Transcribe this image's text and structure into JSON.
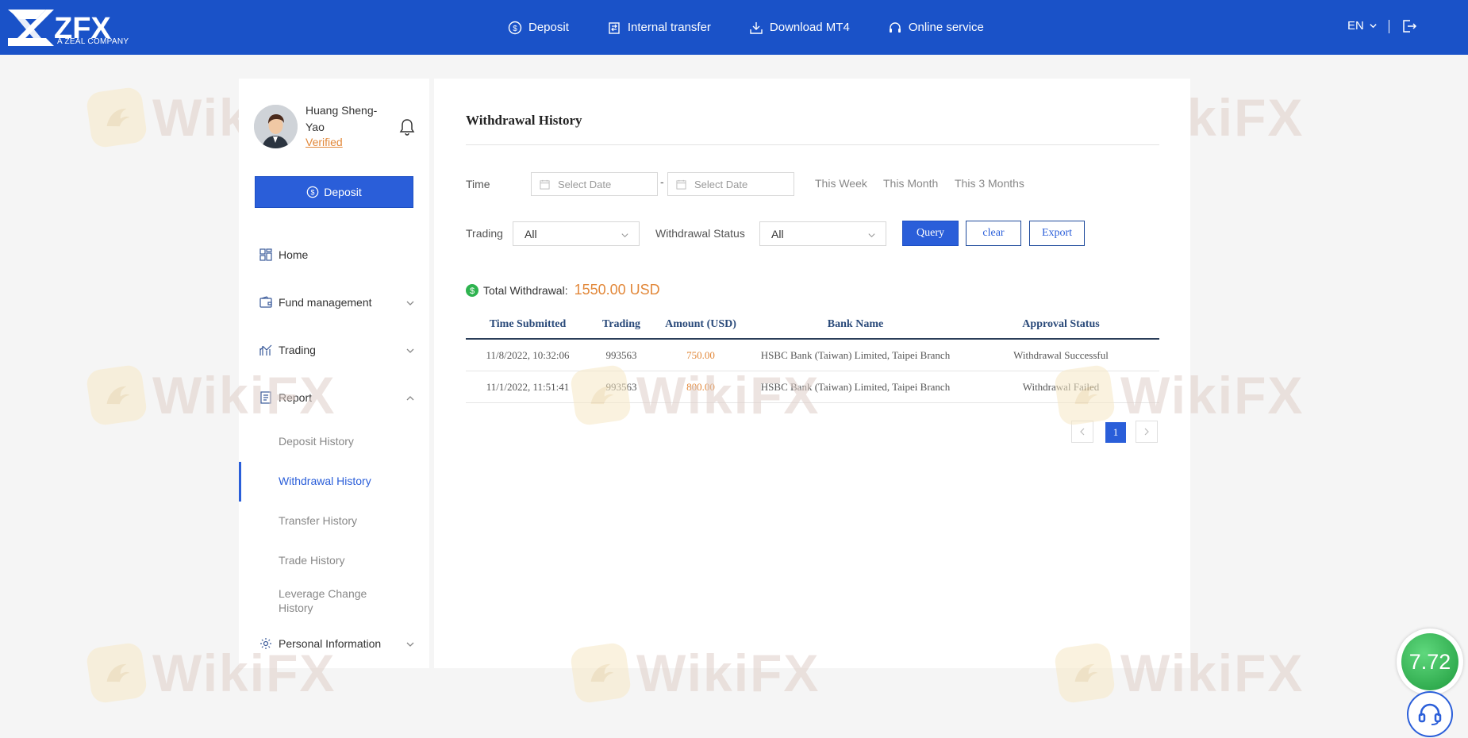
{
  "brand": {
    "name": "ZFX",
    "tagline": "A ZEAL COMPANY"
  },
  "topnav": {
    "items": [
      {
        "label": "Deposit",
        "icon": "dollar-circle-icon"
      },
      {
        "label": "Internal transfer",
        "icon": "transfer-icon"
      },
      {
        "label": "Download MT4",
        "icon": "download-icon"
      },
      {
        "label": "Online service",
        "icon": "headset-icon"
      }
    ],
    "language": "EN"
  },
  "profile": {
    "name": "Huang Sheng-Yao",
    "status": "Verified",
    "deposit_label": "Deposit"
  },
  "sidebar": {
    "items": [
      {
        "label": "Home",
        "icon": "grid-icon"
      },
      {
        "label": "Fund management",
        "icon": "wallet-icon"
      },
      {
        "label": "Trading",
        "icon": "chart-icon"
      },
      {
        "label": "Report",
        "icon": "report-icon"
      },
      {
        "label": "Personal Information",
        "icon": "gear-icon"
      }
    ],
    "report_sub": [
      {
        "label": "Deposit History"
      },
      {
        "label": "Withdrawal History",
        "active": true
      },
      {
        "label": "Transfer History"
      },
      {
        "label": "Trade History"
      },
      {
        "label": "Leverage Change History"
      }
    ]
  },
  "main": {
    "title": "Withdrawal History",
    "filters": {
      "time_label": "Time",
      "start_placeholder": "Select Date",
      "end_placeholder": "Select Date",
      "separator": "-",
      "quick": [
        "This Week",
        "This Month",
        "This 3 Months"
      ],
      "trading_label": "Trading",
      "trading_value": "All",
      "status_label": "Withdrawal Status",
      "status_value": "All",
      "query_label": "Query",
      "clear_label": "clear",
      "export_label": "Export"
    },
    "total": {
      "label": "Total Withdrawal:",
      "value": "1550.00 USD"
    },
    "table": {
      "headers": [
        "Time Submitted",
        "Trading",
        "Amount (USD)",
        "Bank Name",
        "Approval Status"
      ],
      "rows": [
        [
          "11/8/2022, 10:32:06",
          "993563",
          "750.00",
          "HSBC Bank (Taiwan) Limited, Taipei Branch",
          "Withdrawal Successful"
        ],
        [
          "11/1/2022, 11:51:41",
          "993563",
          "800.00",
          "HSBC Bank (Taiwan) Limited, Taipei Branch",
          "Withdrawal Failed"
        ]
      ]
    },
    "pagination": {
      "current": "1"
    }
  },
  "watermark": {
    "text": "WikiFX"
  },
  "rating": {
    "score": "7.72"
  },
  "colors": {
    "primary": "#1a52c8",
    "accent": "#e2883a",
    "rating": "#2eb34f"
  }
}
